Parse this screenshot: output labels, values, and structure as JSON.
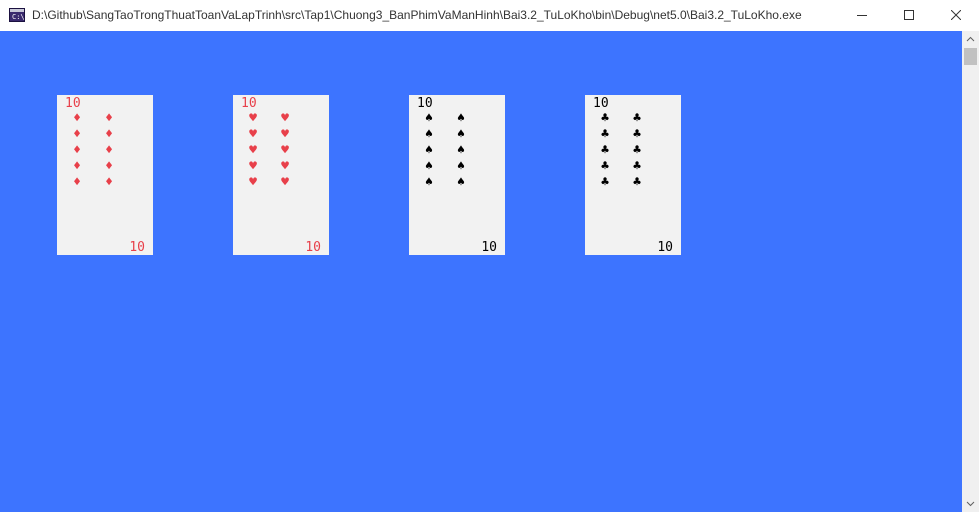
{
  "window": {
    "title": "D:\\Github\\SangTaoTrongThuatToanVaLapTrinh\\src\\Tap1\\Chuong3_BanPhimVaManHinh\\Bai3.2_TuLoKho\\bin\\Debug\\net5.0\\Bai3.2_TuLoKho.exe",
    "app_icon_text": "C:\\",
    "icons": {
      "app": "console-app-icon",
      "minimize": "minimize-icon",
      "maximize": "maximize-icon",
      "close": "close-icon"
    }
  },
  "console": {
    "background": "#3d74ff",
    "card_background": "#f2f2f2"
  },
  "cards": [
    {
      "rank": "10",
      "suit": "diamonds",
      "symbol": "♦",
      "color": "#e8404a"
    },
    {
      "rank": "10",
      "suit": "hearts",
      "symbol": "♥",
      "color": "#e8404a"
    },
    {
      "rank": "10",
      "suit": "spades",
      "symbol": "♠",
      "color": "#000000"
    },
    {
      "rank": "10",
      "suit": "clubs",
      "symbol": "♣",
      "color": "#000000"
    }
  ]
}
